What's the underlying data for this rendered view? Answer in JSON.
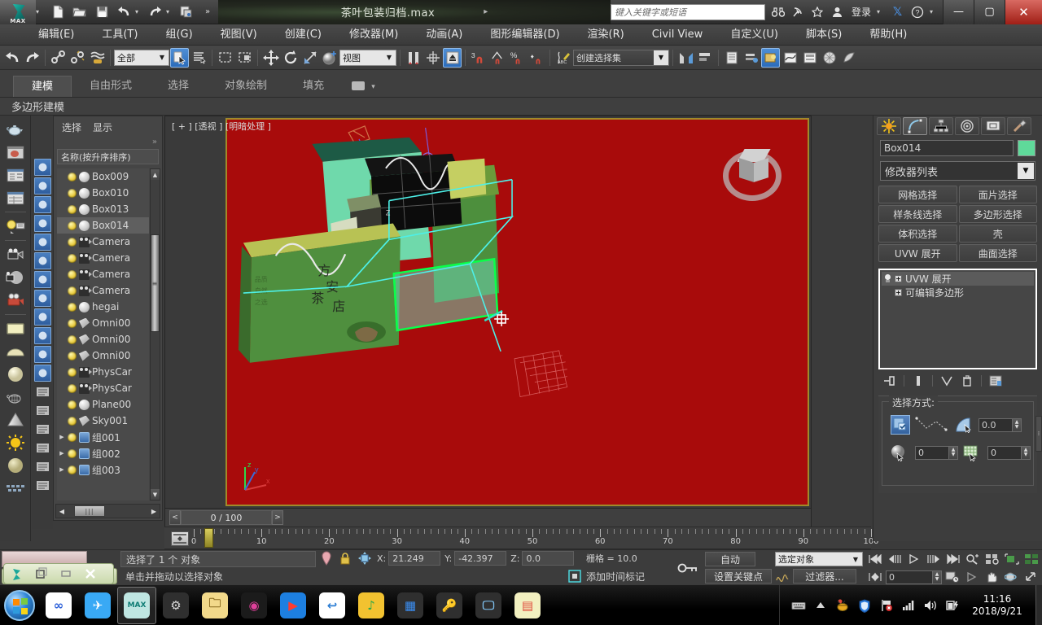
{
  "titlebar": {
    "app_logo_label": "MAX",
    "document_title": "茶叶包装归档.max",
    "search_placeholder": "键入关键字或短语",
    "signin_label": "登录",
    "quick_access": [
      {
        "name": "new-file",
        "glyph": "▢"
      },
      {
        "name": "open-file",
        "glyph": "▣"
      },
      {
        "name": "save-file",
        "glyph": "▤"
      },
      {
        "name": "undo",
        "glyph": "↶"
      },
      {
        "name": "redo",
        "glyph": "↷"
      },
      {
        "name": "project-folder",
        "glyph": "▥"
      },
      {
        "name": "more",
        "glyph": "»"
      }
    ],
    "tray_icons": [
      {
        "name": "binoculars-icon",
        "glyph": "⛛"
      },
      {
        "name": "satellite-icon",
        "glyph": "⤳"
      },
      {
        "name": "star-icon",
        "glyph": "☆"
      },
      {
        "name": "user-icon",
        "glyph": "👤"
      },
      {
        "name": "exchange-icon",
        "glyph": "X"
      },
      {
        "name": "help-icon",
        "glyph": "?"
      }
    ],
    "window_buttons": {
      "minimize": "—",
      "restore": "▢",
      "close": "✕"
    }
  },
  "menu": {
    "items": [
      "编辑(E)",
      "工具(T)",
      "组(G)",
      "视图(V)",
      "创建(C)",
      "修改器(M)",
      "动画(A)",
      "图形编辑器(D)",
      "渲染(R)",
      "Civil View",
      "自定义(U)",
      "脚本(S)",
      "帮助(H)"
    ]
  },
  "main_toolbar": {
    "selection_filter": "全部",
    "ref_coord_system": "视图",
    "named_selection_set": "创建选择集",
    "snap_count": "3",
    "buttons": [
      {
        "name": "undo-button",
        "glyph": "↶"
      },
      {
        "name": "redo-button",
        "glyph": "↷"
      },
      {
        "name": "select-and-link-button",
        "glyph": "🔗"
      },
      {
        "name": "unlink-selection-button",
        "glyph": "⛓"
      },
      {
        "name": "bind-to-space-warp-button",
        "glyph": "≋"
      },
      {
        "name": "select-object-button",
        "glyph": "⬚"
      },
      {
        "name": "select-by-name-button",
        "glyph": "☰"
      },
      {
        "name": "rectangular-select-region-button",
        "glyph": "▭"
      },
      {
        "name": "window-crossing-button",
        "glyph": "▯"
      },
      {
        "name": "select-and-move-button",
        "glyph": "✥"
      },
      {
        "name": "select-and-rotate-button",
        "glyph": "↻"
      },
      {
        "name": "select-and-scale-button",
        "glyph": "⇲"
      },
      {
        "name": "use-center-flyout-button",
        "glyph": "◉"
      },
      {
        "name": "mirror-button",
        "glyph": "⇔"
      },
      {
        "name": "align-button",
        "glyph": "⊹"
      },
      {
        "name": "toggle-scene-explorer-button",
        "glyph": "⬆"
      },
      {
        "name": "snap-toggle-button",
        "glyph": "3"
      },
      {
        "name": "angle-snap-button",
        "glyph": "∡"
      },
      {
        "name": "percent-snap-button",
        "glyph": "%"
      },
      {
        "name": "spinner-snap-button",
        "glyph": "⇅"
      },
      {
        "name": "edit-named-selection-button",
        "glyph": "ABC"
      },
      {
        "name": "mirror-geometry-button",
        "glyph": "ᛝ"
      },
      {
        "name": "align-objects-button",
        "glyph": "⊞"
      },
      {
        "name": "layer-explorer-button",
        "glyph": "▤"
      },
      {
        "name": "ribbon-toggle-button",
        "glyph": "▦"
      },
      {
        "name": "curve-editor-button",
        "glyph": "📈"
      },
      {
        "name": "schematic-view-button",
        "glyph": "▣"
      },
      {
        "name": "material-editor-button",
        "glyph": "◍"
      },
      {
        "name": "render-setup-button",
        "glyph": "🫖"
      }
    ]
  },
  "ribbon": {
    "tabs": [
      "建模",
      "自由形式",
      "选择",
      "对象绘制",
      "填充"
    ],
    "active_tab": "建模",
    "panel_label": "多边形建模",
    "overflow_glyph": "▾"
  },
  "left_toolbar": {
    "icons": [
      {
        "name": "teapot-icon"
      },
      {
        "name": "render-preview-icon"
      },
      {
        "name": "render-settings-icon"
      },
      {
        "name": "render-frame-window-icon"
      },
      {
        "name": "light-lister-icon"
      },
      {
        "name": "camera-match-icon"
      },
      {
        "name": "camera-shade-icon"
      },
      {
        "name": "camera-red-icon"
      },
      {
        "name": "plane-icon"
      },
      {
        "name": "dome-icon"
      },
      {
        "name": "sphere-white-icon"
      },
      {
        "name": "wire-teapot-icon"
      },
      {
        "name": "cone-icon"
      },
      {
        "name": "sun-icon"
      },
      {
        "name": "sphere-gold-icon"
      },
      {
        "name": "grid-icon"
      }
    ],
    "icons2": [
      {
        "name": "sphere-blue-icon"
      },
      {
        "name": "material-icon"
      },
      {
        "name": "light-blue-icon"
      },
      {
        "name": "camera-blue-icon"
      },
      {
        "name": "render-blue-icon"
      },
      {
        "name": "wave-blue-icon"
      },
      {
        "name": "copy-blue-icon"
      },
      {
        "name": "square-blue-icon"
      },
      {
        "name": "spline-blue-icon"
      },
      {
        "name": "light-bulb-blue-icon"
      },
      {
        "name": "effects-blue-icon"
      },
      {
        "name": "scene-blue-icon"
      },
      {
        "name": "list-icon"
      },
      {
        "name": "page-icon"
      },
      {
        "name": "lines-icon"
      },
      {
        "name": "funnel-icon"
      },
      {
        "name": "funnel2-icon"
      },
      {
        "name": "tray-icon"
      }
    ]
  },
  "explorer": {
    "tabs": [
      "选择",
      "显示"
    ],
    "chevron": "»",
    "column_header": "名称(按升序排序)",
    "rows": [
      {
        "name": "Box009",
        "type": "geometry",
        "expandable": false,
        "selected": false
      },
      {
        "name": "Box010",
        "type": "geometry",
        "expandable": false,
        "selected": false
      },
      {
        "name": "Box013",
        "type": "geometry",
        "expandable": false,
        "selected": false
      },
      {
        "name": "Box014",
        "type": "geometry",
        "expandable": false,
        "selected": true
      },
      {
        "name": "Camera",
        "type": "camera",
        "expandable": false,
        "selected": false
      },
      {
        "name": "Camera",
        "type": "camera",
        "expandable": false,
        "selected": false
      },
      {
        "name": "Camera",
        "type": "camera",
        "expandable": false,
        "selected": false
      },
      {
        "name": "Camera",
        "type": "camera",
        "expandable": false,
        "selected": false
      },
      {
        "name": "hegai",
        "type": "geometry",
        "expandable": false,
        "selected": false
      },
      {
        "name": "Omni00",
        "type": "light",
        "expandable": false,
        "selected": false
      },
      {
        "name": "Omni00",
        "type": "light",
        "expandable": false,
        "selected": false
      },
      {
        "name": "Omni00",
        "type": "light",
        "expandable": false,
        "selected": false
      },
      {
        "name": "PhysCar",
        "type": "camera",
        "expandable": false,
        "selected": false
      },
      {
        "name": "PhysCar",
        "type": "camera",
        "expandable": false,
        "selected": false
      },
      {
        "name": "Plane00",
        "type": "geometry",
        "expandable": false,
        "selected": false
      },
      {
        "name": "Sky001",
        "type": "light",
        "expandable": false,
        "selected": false
      },
      {
        "name": "组001",
        "type": "group",
        "expandable": true,
        "selected": false
      },
      {
        "name": "组002",
        "type": "group",
        "expandable": true,
        "selected": false
      },
      {
        "name": "组003",
        "type": "group",
        "expandable": true,
        "selected": false
      }
    ],
    "scroll_grip": "≡"
  },
  "viewport": {
    "label": "[ + ] [透视 ] [明暗处理 ]",
    "background_color": "#a80b0b",
    "border_color": "#a08a2a",
    "selection_color": "#00ff55",
    "gizmo_color": "#44ffcc",
    "frame_indicator": "0 / 100",
    "nav_prev": "<",
    "nav_next": ">"
  },
  "timeline": {
    "labels": [
      "0",
      "10",
      "20",
      "30",
      "40",
      "50",
      "60",
      "70",
      "80",
      "90",
      "100"
    ],
    "start": 0,
    "end": 100,
    "current_frame": 0
  },
  "command_panel": {
    "tabs": [
      {
        "name": "create-tab",
        "glyph": "✷",
        "active": false
      },
      {
        "name": "modify-tab",
        "glyph": "⌒",
        "active": true
      },
      {
        "name": "hierarchy-tab",
        "glyph": "⛫",
        "active": false
      },
      {
        "name": "motion-tab",
        "glyph": "◎",
        "active": false
      },
      {
        "name": "display-tab",
        "glyph": "🖵",
        "active": false
      },
      {
        "name": "utilities-tab",
        "glyph": "🔨",
        "active": false
      }
    ],
    "object_name": "Box014",
    "object_color": "#5fd99a",
    "modifier_list_label": "修改器列表",
    "modifier_buttons": [
      "网格选择",
      "面片选择",
      "样条线选择",
      "多边形选择",
      "体积选择",
      "壳",
      "UVW 展开",
      "曲面选择"
    ],
    "stack": [
      {
        "label": "UVW 展开",
        "selected": true
      },
      {
        "label": "可编辑多边形",
        "selected": false
      }
    ],
    "stack_tools": [
      {
        "name": "pin-stack-icon",
        "glyph": "⊣"
      },
      {
        "name": "show-end-result-icon",
        "glyph": "❙"
      },
      {
        "name": "make-unique-icon",
        "glyph": "⋎"
      },
      {
        "name": "remove-modifier-icon",
        "glyph": "🗑"
      },
      {
        "name": "configure-modifier-sets-icon",
        "glyph": "▤"
      }
    ],
    "rollout_title": "选择方式:",
    "rollout_fields": [
      {
        "name": "ignore-backfacing-checkbox",
        "value": ""
      },
      {
        "name": "planar-angle-field",
        "value": "0.0"
      },
      {
        "name": "select-by-element-field",
        "value": "0"
      },
      {
        "name": "select-by-material-field",
        "value": "0"
      }
    ]
  },
  "status_bar": {
    "prompt_selection": "选择了 1 个 对象",
    "prompt_hint": "单击并拖动以选择对象",
    "coords": [
      {
        "axis": "X:",
        "value": "21.249"
      },
      {
        "axis": "Y:",
        "value": "-42.397"
      },
      {
        "axis": "Z:",
        "value": "0.0"
      }
    ],
    "grid_label": "栅格 = 10.0",
    "add_time_tag": "添加时间标记",
    "auto_key": "自动",
    "set_key": "设置关键点",
    "key_filters": "过滤器...",
    "selection_list": "选定对象",
    "frame_value": "0",
    "lock_icon": "🔒",
    "pin_icon": "📍",
    "absolute_icon": "✥"
  },
  "taskbar": {
    "items": [
      {
        "name": "taskbar-baidu",
        "label": "∞",
        "color": "#ffffff",
        "fg": "#2b5fd9"
      },
      {
        "name": "taskbar-bird",
        "label": "✈",
        "color": "#39a9f5",
        "fg": "#ffffff"
      },
      {
        "name": "taskbar-3dsmax",
        "label": "MAX",
        "color": "#bfe6e2",
        "fg": "#0f7d75",
        "active": true
      },
      {
        "name": "taskbar-tool",
        "label": "⚙",
        "color": "#2f2f2f",
        "fg": "#d9d9d9"
      },
      {
        "name": "taskbar-folder",
        "label": "🗀",
        "color": "#f2d98a",
        "fg": "#8a6b1e"
      },
      {
        "name": "taskbar-camera",
        "label": "◉",
        "color": "#1b1b1b",
        "fg": "#e0409b"
      },
      {
        "name": "taskbar-player",
        "label": "▶",
        "color": "#1d7fe0",
        "fg": "#ff3b2e"
      },
      {
        "name": "taskbar-browser",
        "label": "↩",
        "color": "#ffffff",
        "fg": "#2f7fd4"
      },
      {
        "name": "taskbar-music",
        "label": "♪",
        "color": "#f2c230",
        "fg": "#2aa84a"
      },
      {
        "name": "taskbar-office",
        "label": "▦",
        "color": "#2f2f2f",
        "fg": "#3b8ef2"
      },
      {
        "name": "taskbar-key",
        "label": "🔑",
        "color": "#2f2f2f",
        "fg": "#f2b700"
      },
      {
        "name": "taskbar-monitor",
        "label": "🖵",
        "color": "#2f2f2f",
        "fg": "#7fc2f0"
      },
      {
        "name": "taskbar-notes",
        "label": "▤",
        "color": "#f2f0c0",
        "fg": "#e04a3b"
      }
    ],
    "tray": [
      {
        "name": "keyboard-icon",
        "glyph": "⌨"
      },
      {
        "name": "show-hidden-icon",
        "glyph": "▲"
      },
      {
        "name": "antivirus-icon",
        "glyph": "🐝"
      },
      {
        "name": "shield-icon",
        "glyph": "🛡"
      },
      {
        "name": "network-flag-icon",
        "glyph": "⚑"
      },
      {
        "name": "signal-icon",
        "glyph": "▁▃▅"
      },
      {
        "name": "volume-icon",
        "glyph": "🔊"
      },
      {
        "name": "battery-icon",
        "glyph": "🔋"
      }
    ],
    "clock_time": "11:16",
    "clock_date": "2018/9/21"
  },
  "mini_dialog": {
    "buttons": [
      {
        "name": "mini-max-icon",
        "glyph": "◤"
      },
      {
        "name": "mini-restore-icon",
        "glyph": "❐"
      },
      {
        "name": "mini-minimize-icon",
        "glyph": "▭"
      },
      {
        "name": "mini-close-icon",
        "glyph": "✕"
      }
    ]
  }
}
